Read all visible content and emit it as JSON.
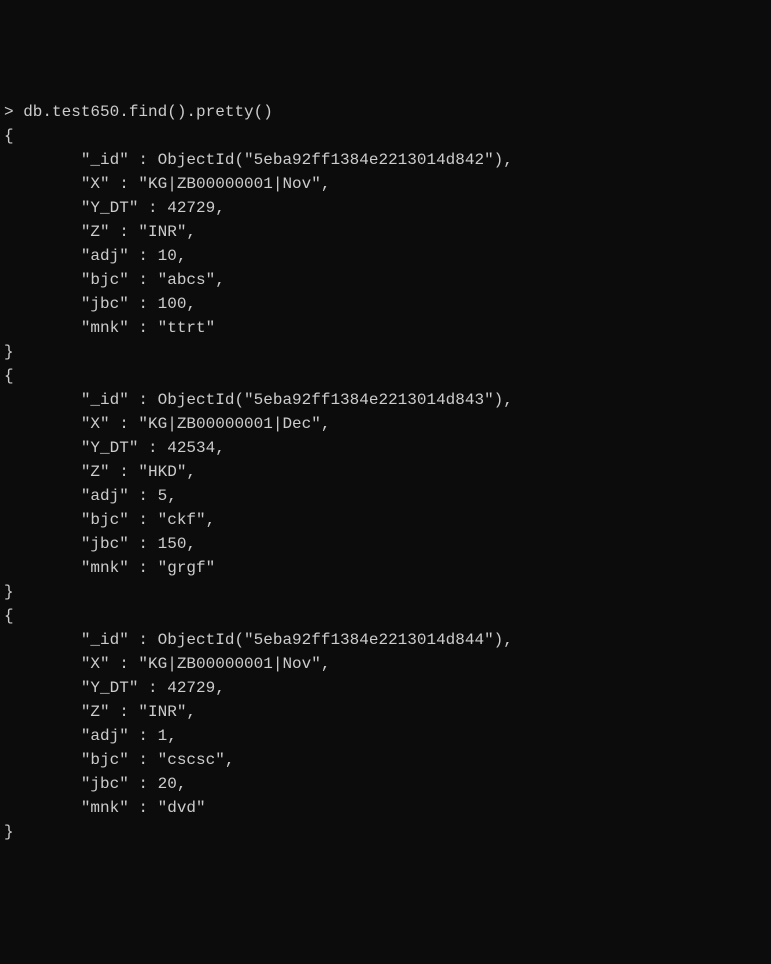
{
  "command": "> db.test650.find().pretty()",
  "records": [
    {
      "open": "{",
      "lines": [
        "        \"_id\" : ObjectId(\"5eba92ff1384e2213014d842\"),",
        "        \"X\" : \"KG|ZB00000001|Nov\",",
        "        \"Y_DT\" : 42729,",
        "        \"Z\" : \"INR\",",
        "        \"adj\" : 10,",
        "        \"bjc\" : \"abcs\",",
        "        \"jbc\" : 100,",
        "        \"mnk\" : \"ttrt\""
      ],
      "close": "}"
    },
    {
      "open": "{",
      "lines": [
        "        \"_id\" : ObjectId(\"5eba92ff1384e2213014d843\"),",
        "        \"X\" : \"KG|ZB00000001|Dec\",",
        "        \"Y_DT\" : 42534,",
        "        \"Z\" : \"HKD\",",
        "        \"adj\" : 5,",
        "        \"bjc\" : \"ckf\",",
        "        \"jbc\" : 150,",
        "        \"mnk\" : \"grgf\""
      ],
      "close": "}"
    },
    {
      "open": "{",
      "lines": [
        "        \"_id\" : ObjectId(\"5eba92ff1384e2213014d844\"),",
        "        \"X\" : \"KG|ZB00000001|Nov\",",
        "        \"Y_DT\" : 42729,",
        "        \"Z\" : \"INR\",",
        "        \"adj\" : 1,",
        "        \"bjc\" : \"cscsc\",",
        "        \"jbc\" : 20,",
        "        \"mnk\" : \"dvd\""
      ],
      "close": "}"
    }
  ]
}
